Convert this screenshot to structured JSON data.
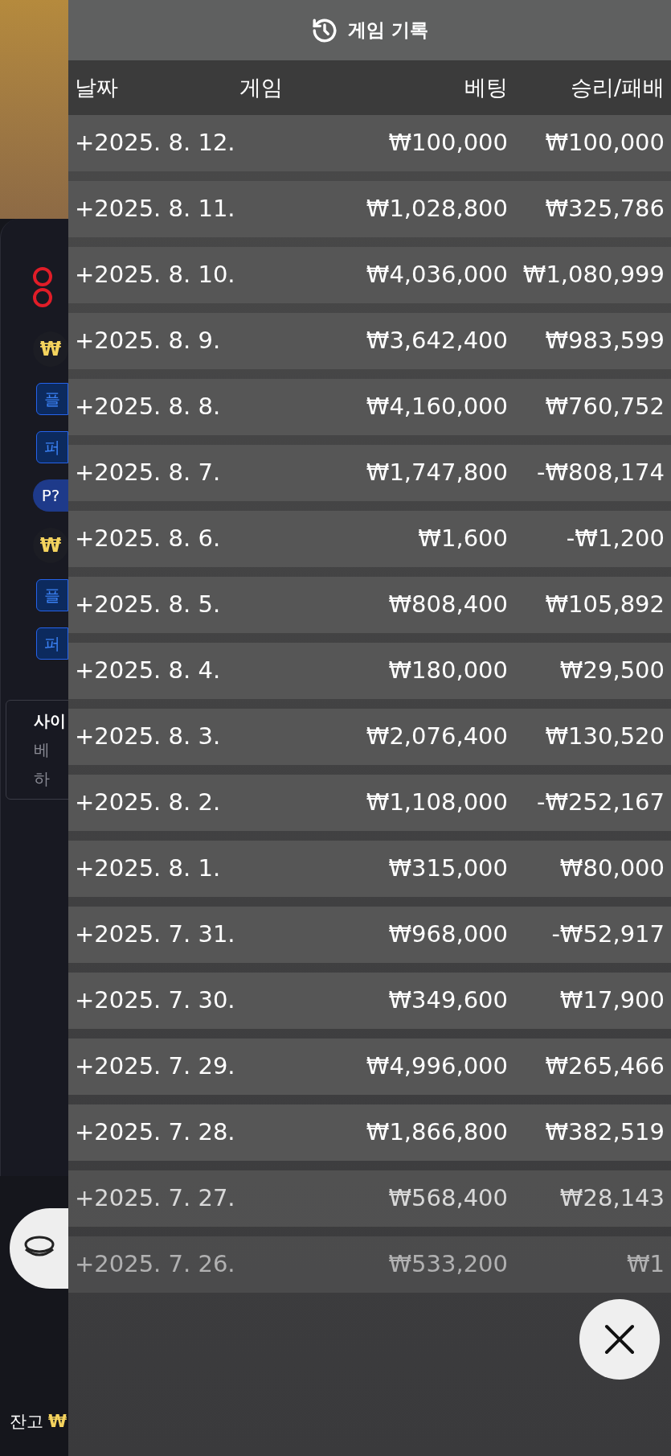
{
  "background": {
    "fragments": [
      {
        "kind": "badge",
        "text": "₩"
      },
      {
        "kind": "bet",
        "text": "플"
      },
      {
        "kind": "bet",
        "text": "퍼"
      },
      {
        "kind": "pill",
        "text": "P?"
      },
      {
        "kind": "badge",
        "text": "₩"
      },
      {
        "kind": "bet",
        "text": "플"
      },
      {
        "kind": "bet",
        "text": "퍼"
      }
    ],
    "notice": {
      "title": "사이",
      "lines": [
        "베",
        "하"
      ]
    },
    "balance": {
      "label": "잔고",
      "currency": "₩"
    }
  },
  "header": {
    "title": "게임 기록"
  },
  "table": {
    "columns": [
      "날짜",
      "게임",
      "베팅",
      "승리/패배"
    ],
    "rows": [
      {
        "date": "+2025. 8. 12.",
        "bet": "₩100,000",
        "result": "₩100,000"
      },
      {
        "date": "+2025. 8. 11.",
        "bet": "₩1,028,800",
        "result": "₩325,786"
      },
      {
        "date": "+2025. 8. 10.",
        "bet": "₩4,036,000",
        "result": "₩1,080,999"
      },
      {
        "date": "+2025. 8. 9.",
        "bet": "₩3,642,400",
        "result": "₩983,599"
      },
      {
        "date": "+2025. 8. 8.",
        "bet": "₩4,160,000",
        "result": "₩760,752"
      },
      {
        "date": "+2025. 8. 7.",
        "bet": "₩1,747,800",
        "result": "-₩808,174"
      },
      {
        "date": "+2025. 8. 6.",
        "bet": "₩1,600",
        "result": "-₩1,200"
      },
      {
        "date": "+2025. 8. 5.",
        "bet": "₩808,400",
        "result": "₩105,892"
      },
      {
        "date": "+2025. 8. 4.",
        "bet": "₩180,000",
        "result": "₩29,500"
      },
      {
        "date": "+2025. 8. 3.",
        "bet": "₩2,076,400",
        "result": "₩130,520"
      },
      {
        "date": "+2025. 8. 2.",
        "bet": "₩1,108,000",
        "result": "-₩252,167"
      },
      {
        "date": "+2025. 8. 1.",
        "bet": "₩315,000",
        "result": "₩80,000"
      },
      {
        "date": "+2025. 7. 31.",
        "bet": "₩968,000",
        "result": "-₩52,917"
      },
      {
        "date": "+2025. 7. 30.",
        "bet": "₩349,600",
        "result": "₩17,900"
      },
      {
        "date": "+2025. 7. 29.",
        "bet": "₩4,996,000",
        "result": "₩265,466"
      },
      {
        "date": "+2025. 7. 28.",
        "bet": "₩1,866,800",
        "result": "₩382,519"
      },
      {
        "date": "+2025. 7. 27.",
        "bet": "₩568,400",
        "result": "₩28,143"
      },
      {
        "date": "+2025. 7. 26.",
        "bet": "₩533,200",
        "result": "₩1"
      }
    ]
  }
}
